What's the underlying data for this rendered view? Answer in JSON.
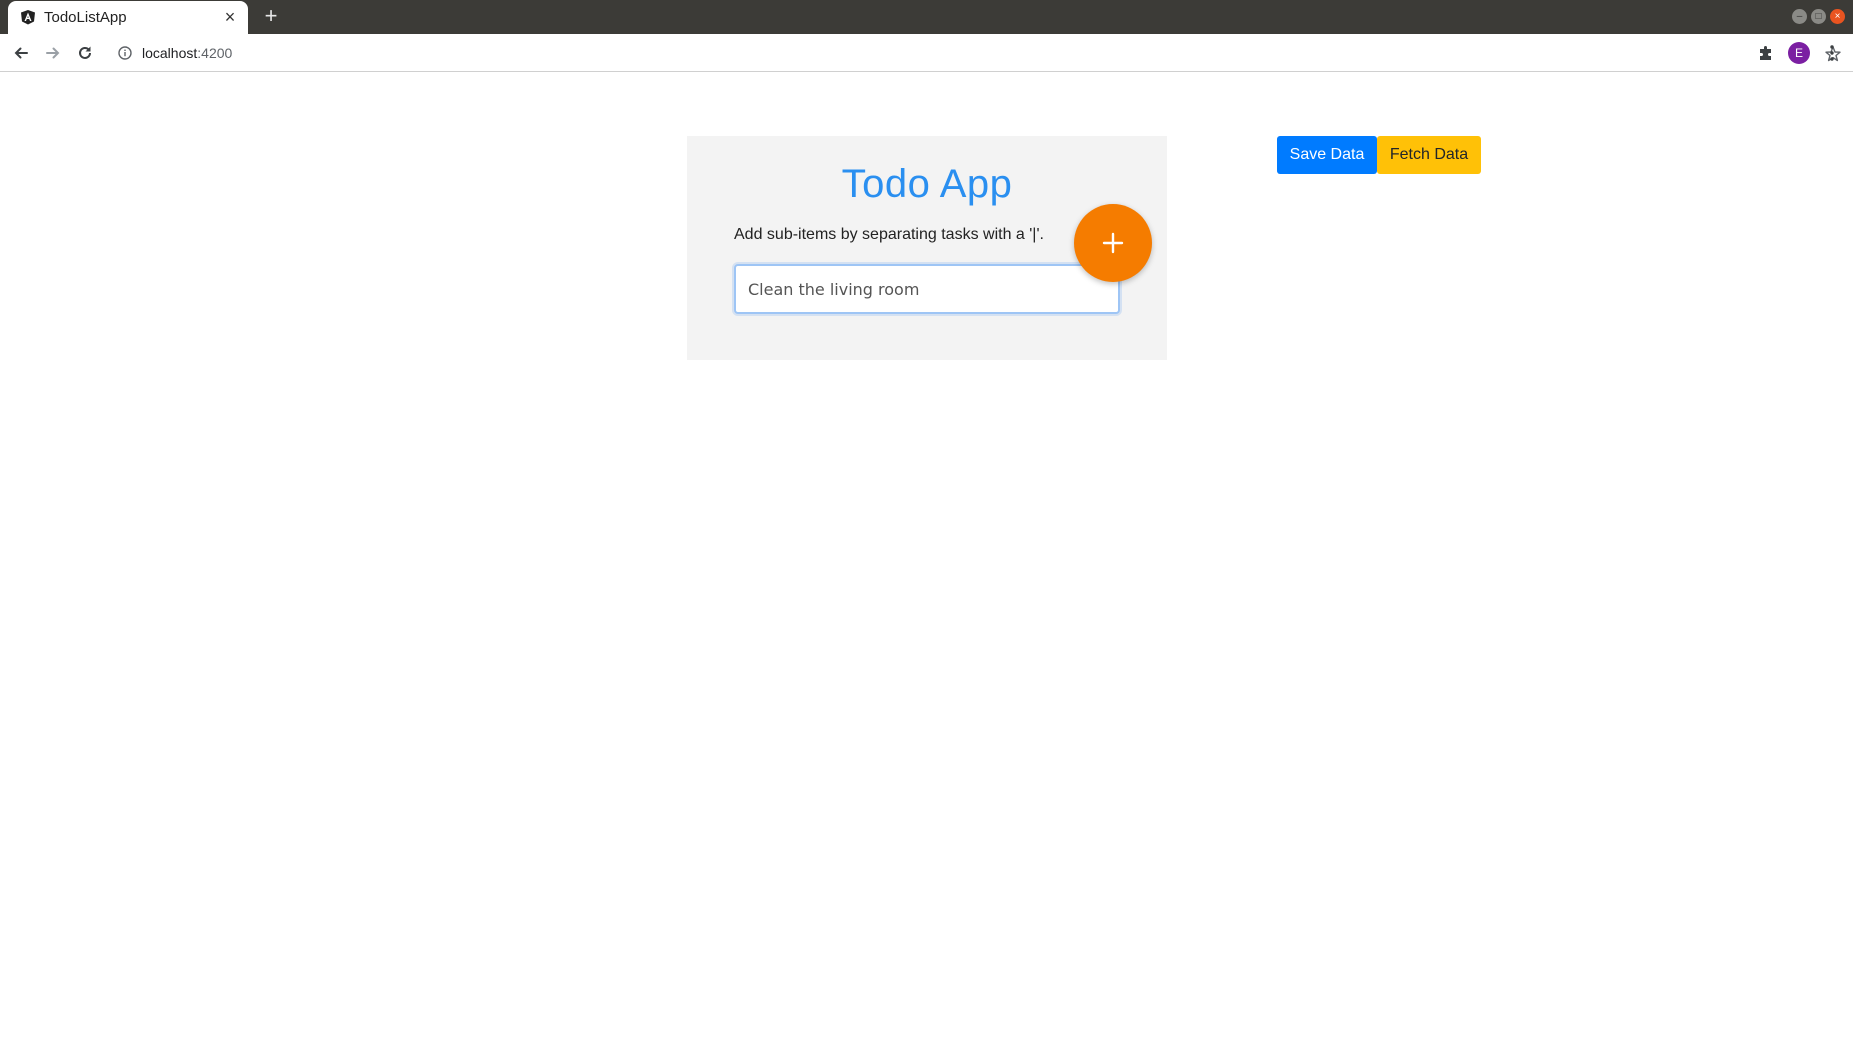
{
  "browser": {
    "tab": {
      "title": "TodoListApp",
      "close_glyph": "×",
      "favicon": "angular-logo-icon"
    },
    "new_tab_glyph": "+",
    "window_controls": {
      "minimize": "–",
      "maximize": "□",
      "close": "×"
    },
    "url": {
      "host": "localhost",
      "port": ":4200"
    },
    "profile_initial": "E",
    "colors": {
      "tabbar": "#3c3b37",
      "profile": "#7b1fa2",
      "close": "#e95420"
    }
  },
  "app": {
    "title": "Todo App",
    "hint": "Add sub-items by separating tasks with a '|'.",
    "input": {
      "value": "Clean the living room",
      "placeholder": ""
    },
    "add_button_icon": "plus-icon",
    "actions": {
      "save_label": "Save Data",
      "fetch_label": "Fetch Data"
    },
    "colors": {
      "title": "#2a8ff0",
      "card_bg": "#f3f3f3",
      "fab": "#f57c00",
      "save": "#007bff",
      "fetch": "#ffc107"
    }
  }
}
